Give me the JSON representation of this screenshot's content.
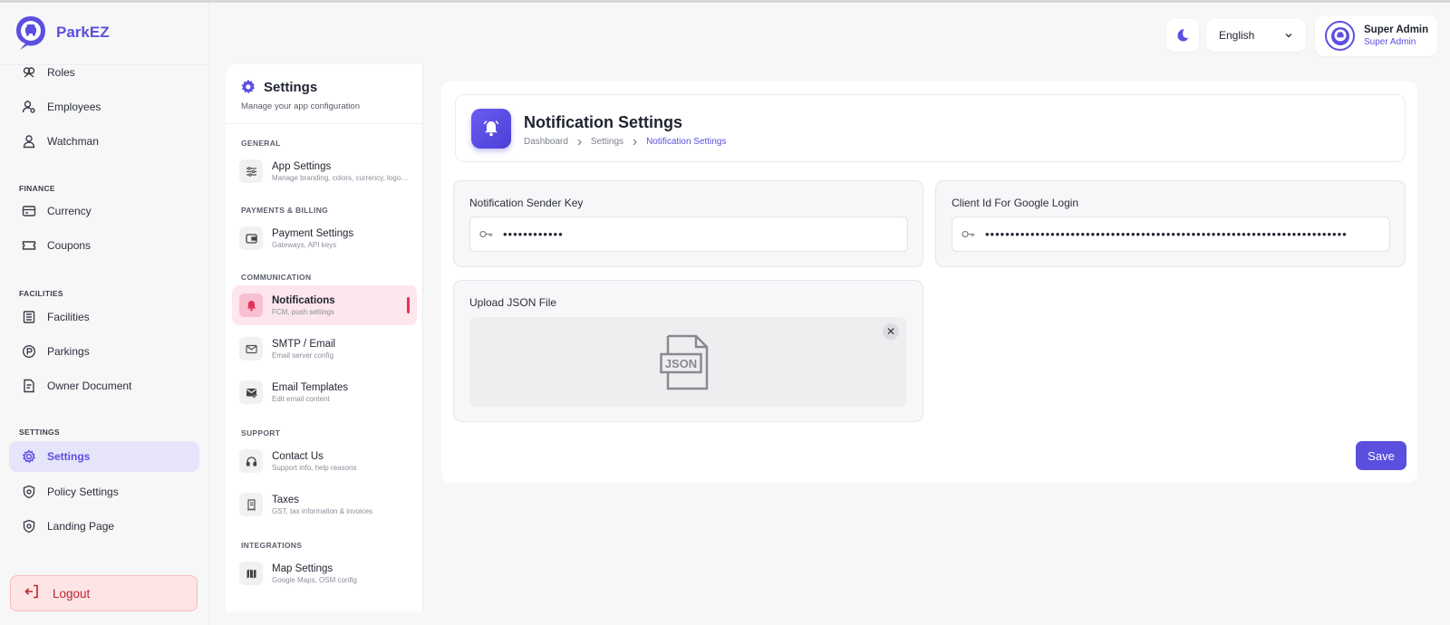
{
  "brand": {
    "name": "ParkEZ"
  },
  "sidebar": {
    "items": [
      {
        "label": "Roles",
        "icon": "roles-icon"
      },
      {
        "label": "Employees",
        "icon": "user-gear-icon"
      },
      {
        "label": "Watchman",
        "icon": "user-icon"
      },
      {
        "label": "Currency",
        "icon": "wallet-icon"
      },
      {
        "label": "Coupons",
        "icon": "ticket-icon"
      },
      {
        "label": "Facilities",
        "icon": "building-icon"
      },
      {
        "label": "Parkings",
        "icon": "parking-icon"
      },
      {
        "label": "Owner Document",
        "icon": "document-icon"
      },
      {
        "label": "Settings",
        "icon": "gear-icon",
        "active": true
      },
      {
        "label": "Policy Settings",
        "icon": "shield-icon"
      },
      {
        "label": "Landing Page",
        "icon": "shield-icon"
      }
    ],
    "sections": {
      "finance": "FINANCE",
      "facilities": "FACILITIES",
      "settings": "SETTINGS"
    },
    "logout_label": "Logout"
  },
  "topbar": {
    "language": "English",
    "user_name": "Super Admin",
    "user_role": "Super Admin"
  },
  "settings_panel": {
    "title": "Settings",
    "subtitle": "Manage your app configuration",
    "sections": {
      "general": "GENERAL",
      "payments": "PAYMENTS & BILLING",
      "communication": "COMMUNICATION",
      "support": "SUPPORT",
      "integrations": "INTEGRATIONS"
    },
    "items": [
      {
        "title": "App Settings",
        "desc": "Manage branding, colors, currency, logo…"
      },
      {
        "title": "Payment Settings",
        "desc": "Gateways, API keys"
      },
      {
        "title": "Notifications",
        "desc": "FCM, push settings"
      },
      {
        "title": "SMTP / Email",
        "desc": "Email server config"
      },
      {
        "title": "Email Templates",
        "desc": "Edit email content"
      },
      {
        "title": "Contact Us",
        "desc": "Support info, help reasons"
      },
      {
        "title": "Taxes",
        "desc": "GST, tax information & invoices"
      },
      {
        "title": "Map Settings",
        "desc": "Google Maps, OSM config"
      }
    ]
  },
  "page": {
    "title": "Notification Settings",
    "breadcrumb": [
      "Dashboard",
      "Settings",
      "Notification Settings"
    ]
  },
  "form": {
    "sender_key_label": "Notification Sender Key",
    "sender_key_value": "••••••••••••",
    "google_client_label": "Client Id For Google Login",
    "google_client_value": "••••••••••••••••••••••••••••••••••••••••••••••••••••••••••••••••••••••••",
    "upload_label": "Upload JSON File",
    "file_badge": "JSON",
    "close_glyph": "✕",
    "save_label": "Save"
  },
  "colors": {
    "accent": "#5b4fe0",
    "danger": "#e5315a",
    "logout_bg": "#fde4e5"
  }
}
